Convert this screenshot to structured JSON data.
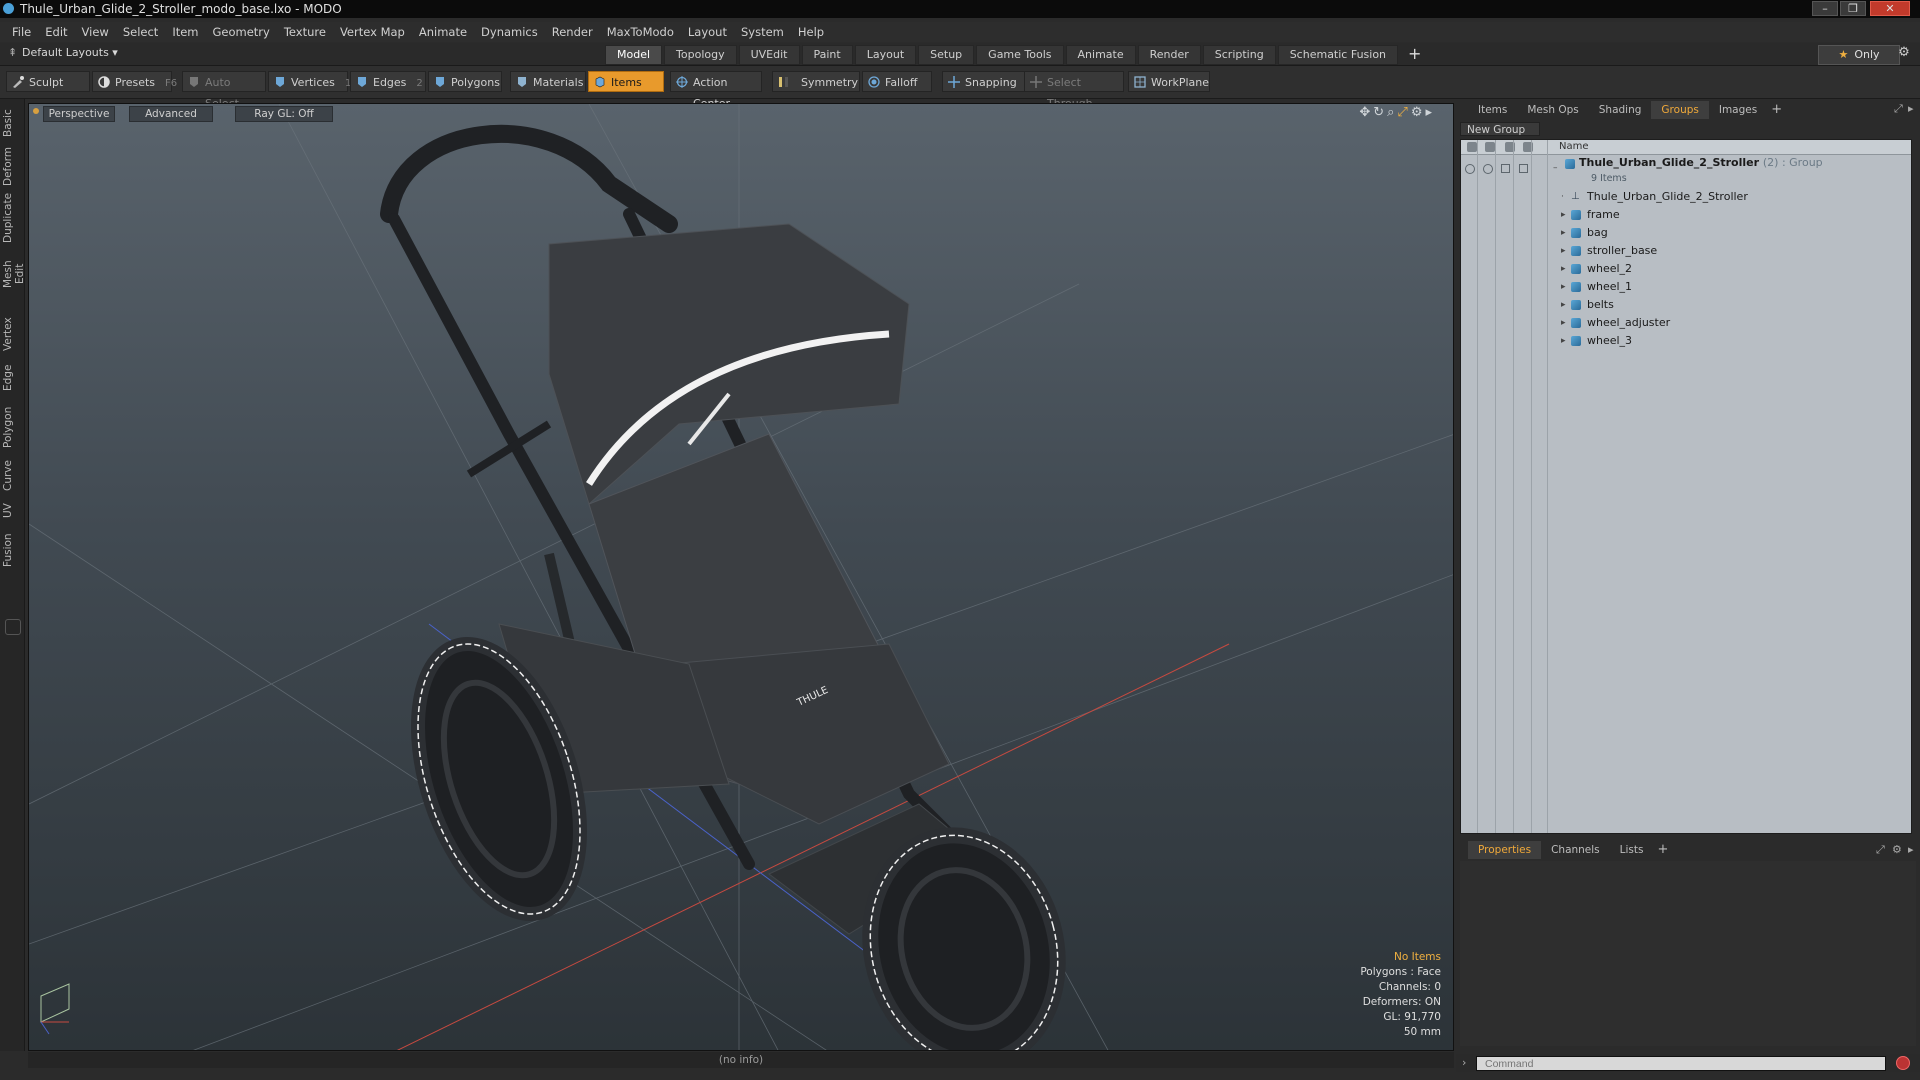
{
  "window": {
    "title": "Thule_Urban_Glide_2_Stroller_modo_base.lxo - MODO",
    "controls": [
      "–",
      "❐",
      "✕"
    ]
  },
  "menu": [
    "File",
    "Edit",
    "View",
    "Select",
    "Item",
    "Geometry",
    "Texture",
    "Vertex Map",
    "Animate",
    "Dynamics",
    "Render",
    "MaxToModo",
    "Layout",
    "System",
    "Help"
  ],
  "layout_select": "Default Layouts ▾",
  "tabs": [
    "Model",
    "Topology",
    "UVEdit",
    "Paint",
    "Layout",
    "Setup",
    "Game Tools",
    "Animate",
    "Render",
    "Scripting",
    "Schematic Fusion"
  ],
  "tab_plus": "+",
  "only_label": "Only",
  "toolbar": {
    "sculpt": "Sculpt",
    "presets": "Presets",
    "presets_key": "F6",
    "auto_select": "Auto Select",
    "vertices": "Vertices",
    "vertices_count": "1",
    "edges": "Edges",
    "edges_count": "2",
    "polygons": "Polygons",
    "materials": "Materials",
    "items": "Items",
    "action_center": "Action Center",
    "symmetry": "Symmetry",
    "falloff": "Falloff",
    "snapping": "Snapping",
    "select_through": "Select Through",
    "workplane": "WorkPlane"
  },
  "left_tabs": [
    "Basic",
    "Deform",
    "Duplicate",
    "Mesh Edit",
    "Vertex",
    "Edge",
    "Polygon",
    "Curve",
    "UV",
    "Fusion"
  ],
  "viewport": {
    "view": "Perspective",
    "mode": "Advanced",
    "raygl": "Ray GL: Off",
    "hud": {
      "selection": "No Items",
      "polygons": "Polygons : Face",
      "channels": "Channels: 0",
      "deformers": "Deformers: ON",
      "gl": "GL: 91,770",
      "scale": "50 mm"
    },
    "logo_text": "THULE"
  },
  "status_info": "(no info)",
  "right_panel": {
    "tabs": [
      "Items",
      "Mesh Ops",
      "Shading",
      "Groups",
      "Images"
    ],
    "active_tab": "Groups",
    "new_group": "New Group",
    "column_name": "Name",
    "group": {
      "name": "Thule_Urban_Glide_2_Stroller",
      "suffix": "(2) : Group",
      "count": "9 Items"
    },
    "items": [
      "Thule_Urban_Glide_2_Stroller",
      "frame",
      "bag",
      "stroller_base",
      "wheel_2",
      "wheel_1",
      "belts",
      "wheel_adjuster",
      "wheel_3"
    ]
  },
  "properties_panel": {
    "tabs": [
      "Properties",
      "Channels",
      "Lists"
    ],
    "active_tab": "Properties"
  },
  "command": {
    "placeholder": "Command"
  },
  "colors": {
    "accent_orange": "#e89a2c",
    "active_tab_text": "#f0a93a",
    "hud_warning": "#f0b040"
  }
}
